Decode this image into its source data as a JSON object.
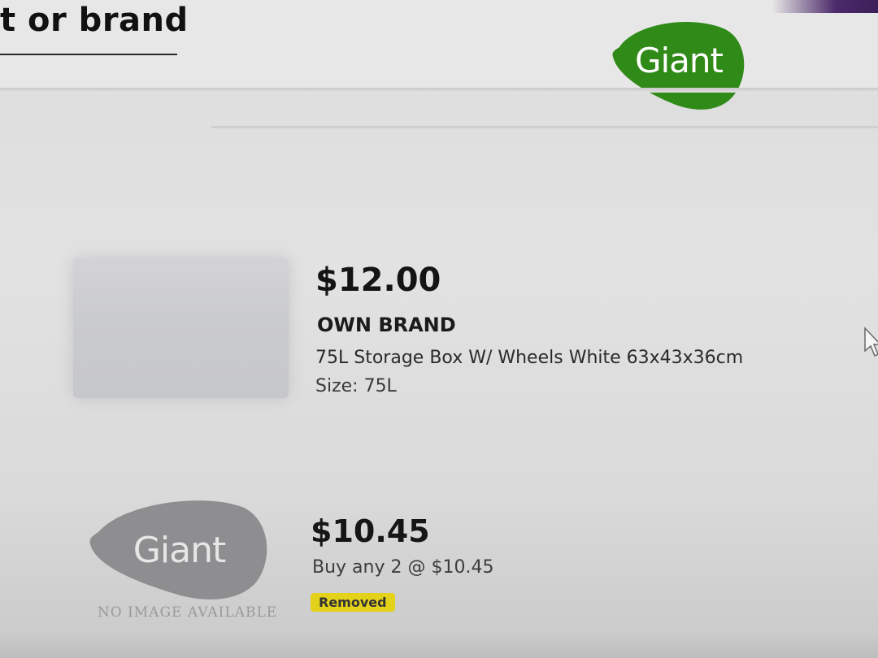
{
  "search": {
    "visible_fragment": "t or brand"
  },
  "logo": {
    "text": "Giant",
    "color": "#2f8a17"
  },
  "products": [
    {
      "price": "$12.00",
      "brand": "OWN BRAND",
      "name": "75L Storage Box W/ Wheels White 63x43x36cm",
      "size": "Size: 75L"
    },
    {
      "price": "$10.45",
      "promo": "Buy any 2 @ $10.45",
      "status": "Removed",
      "status_color": "#e4d21a",
      "placeholder_logo": "Giant",
      "placeholder_caption": "NO IMAGE AVAILABLE"
    }
  ],
  "icons": {
    "cursor": "arrow-cursor-icon"
  }
}
